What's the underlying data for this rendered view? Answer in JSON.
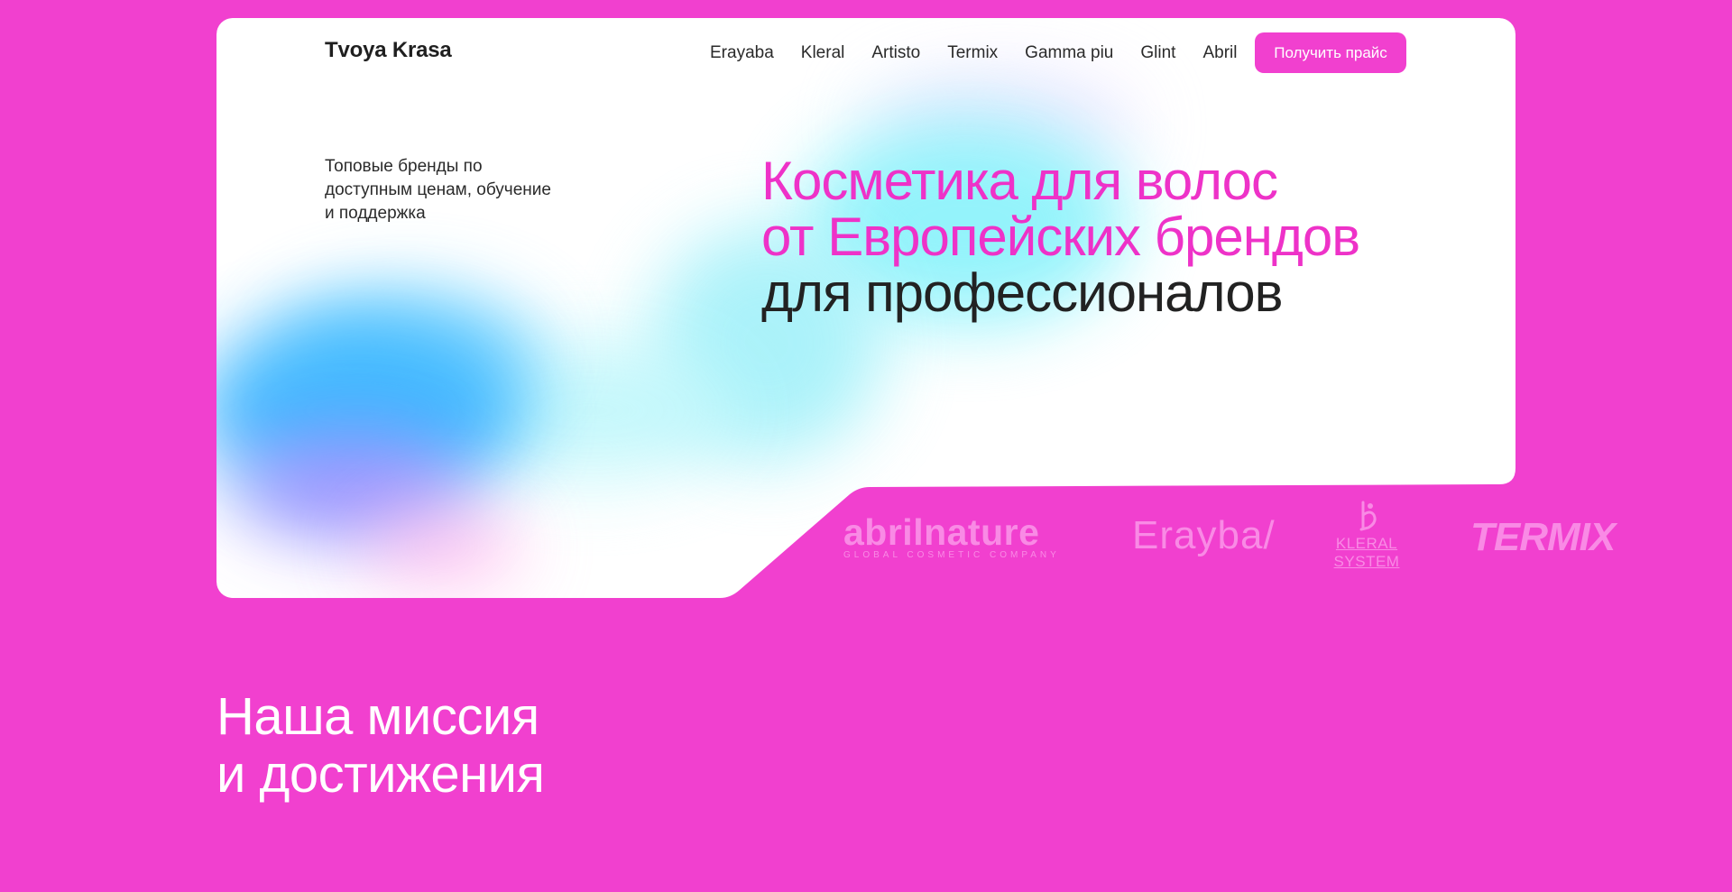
{
  "header": {
    "logo": "Tvoya Krasa",
    "nav": [
      "Erayaba",
      "Kleral",
      "Artisto",
      "Termix",
      "Gamma piu",
      "Glint",
      "Abril"
    ],
    "cta": "Получить прайс"
  },
  "hero": {
    "tagline": "Топовые бренды по доступным ценам, обучение и поддержка",
    "headline_line1": "Косметика для волос",
    "headline_line2": "от Европейских брендов",
    "headline_line3": "для профессионалов"
  },
  "brands": {
    "abril": "abrilnature",
    "abril_sub": "GLOBAL COSMETIC COMPANY",
    "erayba": "Erayba/",
    "kleral": "KLERAL SYSTEM",
    "termix": "TERMIX"
  },
  "mission": {
    "line1": "Наша миссия",
    "line2": "и достижения"
  },
  "colors": {
    "accent": "#f140cf",
    "headline_pink": "#ee32c8",
    "brand_logo": "#f98ae5",
    "text_dark": "#222222"
  }
}
